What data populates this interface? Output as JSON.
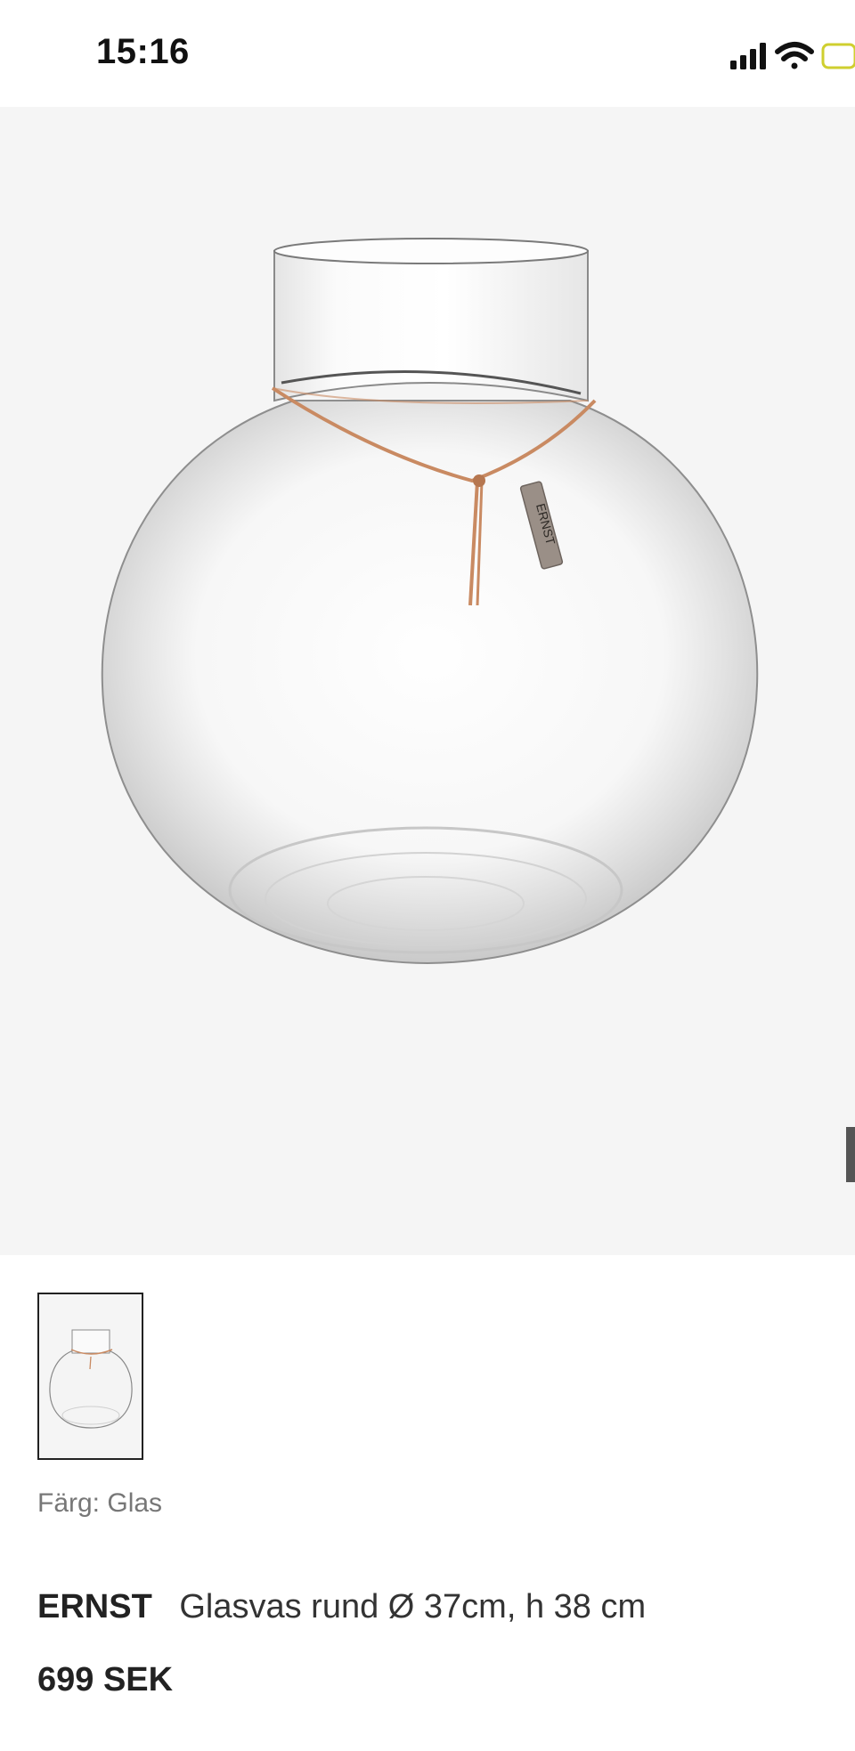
{
  "status_bar": {
    "time": "15:16",
    "icons": [
      "signal-icon",
      "wifi-icon",
      "battery-icon"
    ]
  },
  "product": {
    "image_name": "vase-image",
    "thumbnail_name": "vase-thumbnail",
    "tag_text": "ERNST",
    "color_label": "Färg: Glas",
    "brand": "ERNST",
    "name": "Glasvas rund Ø 37cm, h 38 cm",
    "price": "699 SEK"
  },
  "colors": {
    "background": "#f5f5f5",
    "strap": "#c98a62",
    "tag": "#9a8f87",
    "text": "#222222",
    "muted": "#777777"
  }
}
